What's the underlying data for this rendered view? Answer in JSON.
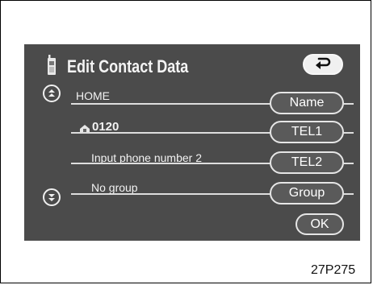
{
  "header": {
    "title": "Edit Contact Data",
    "icon": "phone-icon",
    "back_icon": "return-arrow-icon"
  },
  "fields": [
    {
      "value": "HOME",
      "button": "Name"
    },
    {
      "value": "0120",
      "button": "TEL1",
      "prefix_icon": "home-phone-icon"
    },
    {
      "value": "Input phone number 2",
      "button": "TEL2"
    },
    {
      "value": "No group",
      "button": "Group"
    }
  ],
  "scroll": {
    "up_icon": "page-up-icon",
    "down_icon": "page-down-icon"
  },
  "ok_label": "OK",
  "figure_code": "27P275",
  "colors": {
    "screen_bg": "#4b4b4b",
    "text": "#f2f2f2",
    "button_light_bg": "#f0f0f0"
  }
}
